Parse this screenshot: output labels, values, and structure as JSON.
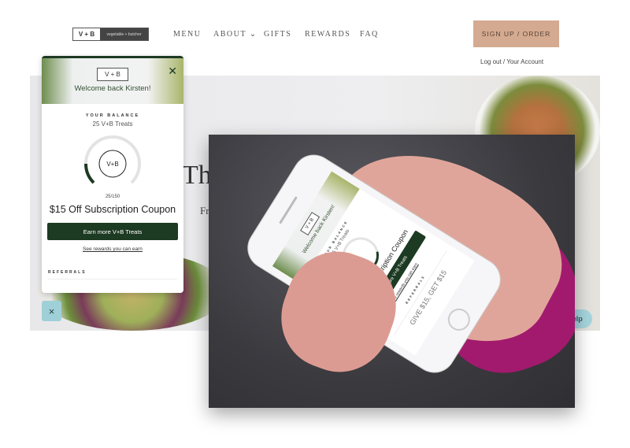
{
  "site": {
    "logo": {
      "mark": "V + B",
      "name": "vegetable + butcher"
    },
    "nav": [
      {
        "label": "MENU"
      },
      {
        "label": "ABOUT ⌄"
      },
      {
        "label": "GIFTS"
      },
      {
        "label": "REWARDS"
      },
      {
        "label": "FAQ"
      }
    ],
    "cta": "SIGN UP / ORDER",
    "account": "Log out / Your Account",
    "hero_title": "Th",
    "hero_subtitle": "Fr",
    "help": "Help"
  },
  "widget": {
    "logo": "V + B",
    "welcome": "Welcome back Kirsten!",
    "balance_label": "YOUR BALANCE",
    "balance": "25 V+B Treats",
    "ring_logo": "V+B",
    "progress_text": "25/150",
    "progress": 0.1667,
    "reward": "$15 Off Subscription Coupon",
    "earn_button": "Earn more V+B Treats",
    "rewards_link": "See rewards you can earn",
    "referrals_label": "REFERRALS",
    "close": "×"
  },
  "phone": {
    "referral_text": "GIVE $15, GET $15"
  },
  "colors": {
    "brand_green": "#1d3a22",
    "cta": "#d4aa90",
    "launcher": "#9fd0d8"
  }
}
